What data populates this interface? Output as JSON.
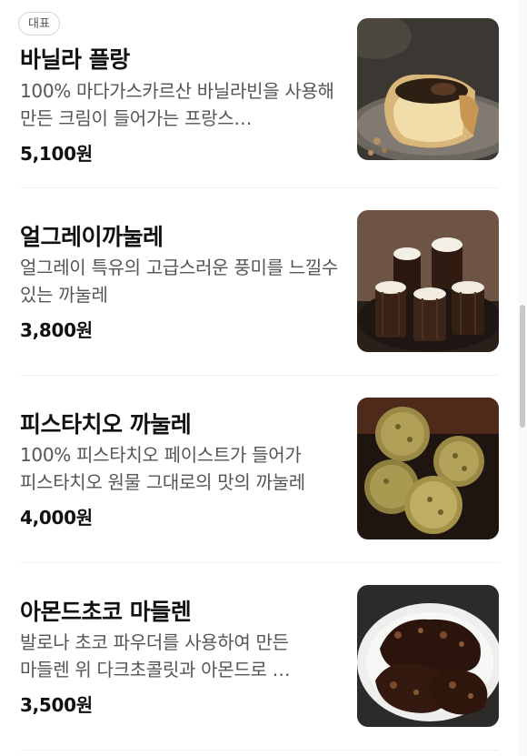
{
  "menu": {
    "items": [
      {
        "badge": "대표",
        "name": "바닐라 플랑",
        "description": "100% 마다가스카르산 바닐라빈을 사용해 만든 크림이 들어가는 프랑스…",
        "price": "5,100원",
        "image_icon": "vanilla-flan-photo"
      },
      {
        "name": "얼그레이까눌레",
        "description": "얼그레이 특유의 고급스러운 풍미를 느낄수 있는 까눌레",
        "price": "3,800원",
        "image_icon": "earl-grey-canele-photo"
      },
      {
        "name": "피스타치오 까눌레",
        "description": "100% 피스타치오 페이스트가 들어가 피스타치오 원물 그대로의 맛의 까눌레",
        "price": "4,000원",
        "image_icon": "pistachio-canele-photo"
      },
      {
        "name": "아몬드초코 마들렌",
        "description": "발로나 초코 파우더를 사용하여 만든 마들렌 위 다크초콜릿과 아몬드로 …",
        "price": "3,500원",
        "image_icon": "almond-choco-madeleine-photo"
      }
    ]
  },
  "colors": {
    "text_primary": "#111111",
    "text_secondary": "#555555",
    "divider": "#f0f0f0",
    "badge_border": "#d6d6d6"
  }
}
